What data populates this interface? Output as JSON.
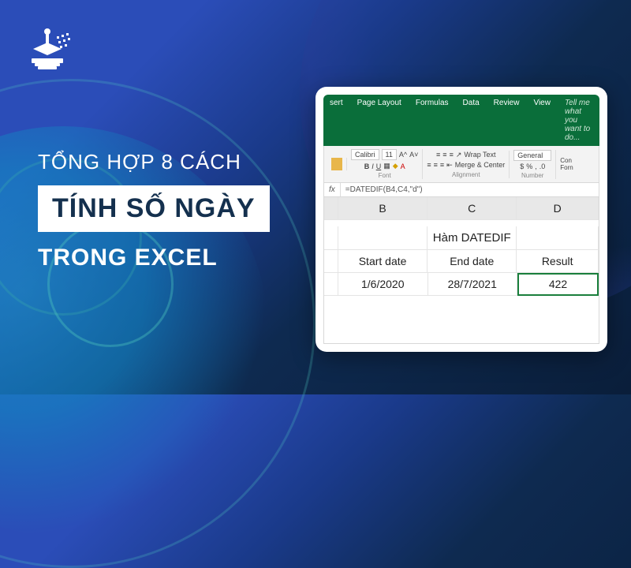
{
  "text": {
    "line1": "TỔNG HỢP 8 CÁCH",
    "line2": "TÍNH SỐ NGÀY",
    "line3": "TRONG EXCEL"
  },
  "ribbon": {
    "tabs": [
      "sert",
      "Page Layout",
      "Formulas",
      "Data",
      "Review",
      "View"
    ],
    "tell": "Tell me what you want to do...",
    "font_name": "Calibri",
    "font_size": "11",
    "wrap": "Wrap Text",
    "merge": "Merge & Center",
    "numfmt": "General",
    "grp_font": "Font",
    "grp_align": "Alignment",
    "grp_number": "Number",
    "cond": "Con\nForn"
  },
  "formula": {
    "fx": "fx",
    "text": "=DATEDIF(B4,C4,\"d\")"
  },
  "sheet": {
    "cols": {
      "b": "B",
      "c": "C",
      "d": "D"
    },
    "title": "Hàm DATEDIF",
    "headers": {
      "b": "Start date",
      "c": "End date",
      "d": "Result"
    },
    "data": {
      "b": "1/6/2020",
      "c": "28/7/2021",
      "d": "422"
    }
  },
  "chart_data": {
    "type": "table",
    "title": "Hàm DATEDIF",
    "columns": [
      "Start date",
      "End date",
      "Result"
    ],
    "rows": [
      [
        "1/6/2020",
        "28/7/2021",
        422
      ]
    ],
    "formula": "=DATEDIF(B4,C4,\"d\")"
  }
}
